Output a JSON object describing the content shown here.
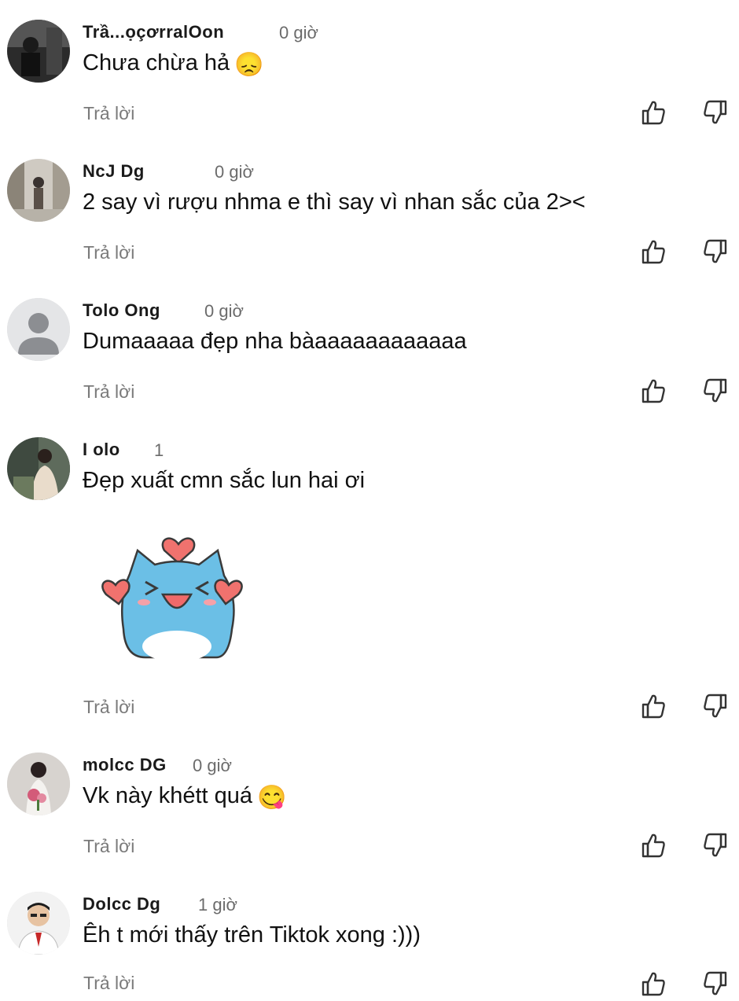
{
  "comments": [
    {
      "author": "Trầ...ọçơrralOon",
      "time": "0 giờ",
      "text": "Chưa chừa hả",
      "emoji": "😞",
      "reply": "Trả lời",
      "avatar": "photo-dark"
    },
    {
      "author": "NcJ Dg",
      "time": "0 giờ",
      "text": "2 say vì rượu nhma e thì say vì nhan sắc của 2><",
      "emoji": "",
      "reply": "Trả lời",
      "avatar": "photo-light"
    },
    {
      "author": "Tolo Ong",
      "time": "0 giờ",
      "text": "Dumaaaaa đẹp nha bàaaaaaaaaaaaa",
      "emoji": "",
      "reply": "Trả lời",
      "avatar": "default-user"
    },
    {
      "author": "I olo",
      "time": "1",
      "text": "Đẹp xuất cmn sắc lun hai ơi",
      "emoji": "",
      "reply": "Trả lời",
      "avatar": "photo-warm",
      "sticker": "blue-cat-hearts-sticker"
    },
    {
      "author": "molcc DG",
      "time": "0 giờ",
      "text": "Vk này khétt quá",
      "emoji": "😋",
      "reply": "Trả lời",
      "avatar": "photo-bouquet"
    },
    {
      "author": "Dolcc Dg",
      "time": "1 giờ",
      "text": "Êh t mới thấy trên Tiktok xong :)))",
      "emoji": "",
      "reply": "Trả lời",
      "avatar": "photo-man"
    }
  ],
  "colors": {
    "text": "#111111",
    "meta": "#7a7a7a",
    "icon": "#333333",
    "sticker_body": "#6bbfe6",
    "sticker_heart": "#f0726e"
  },
  "icons": {
    "like": "thumbs-up-icon",
    "dislike": "thumbs-down-icon"
  }
}
